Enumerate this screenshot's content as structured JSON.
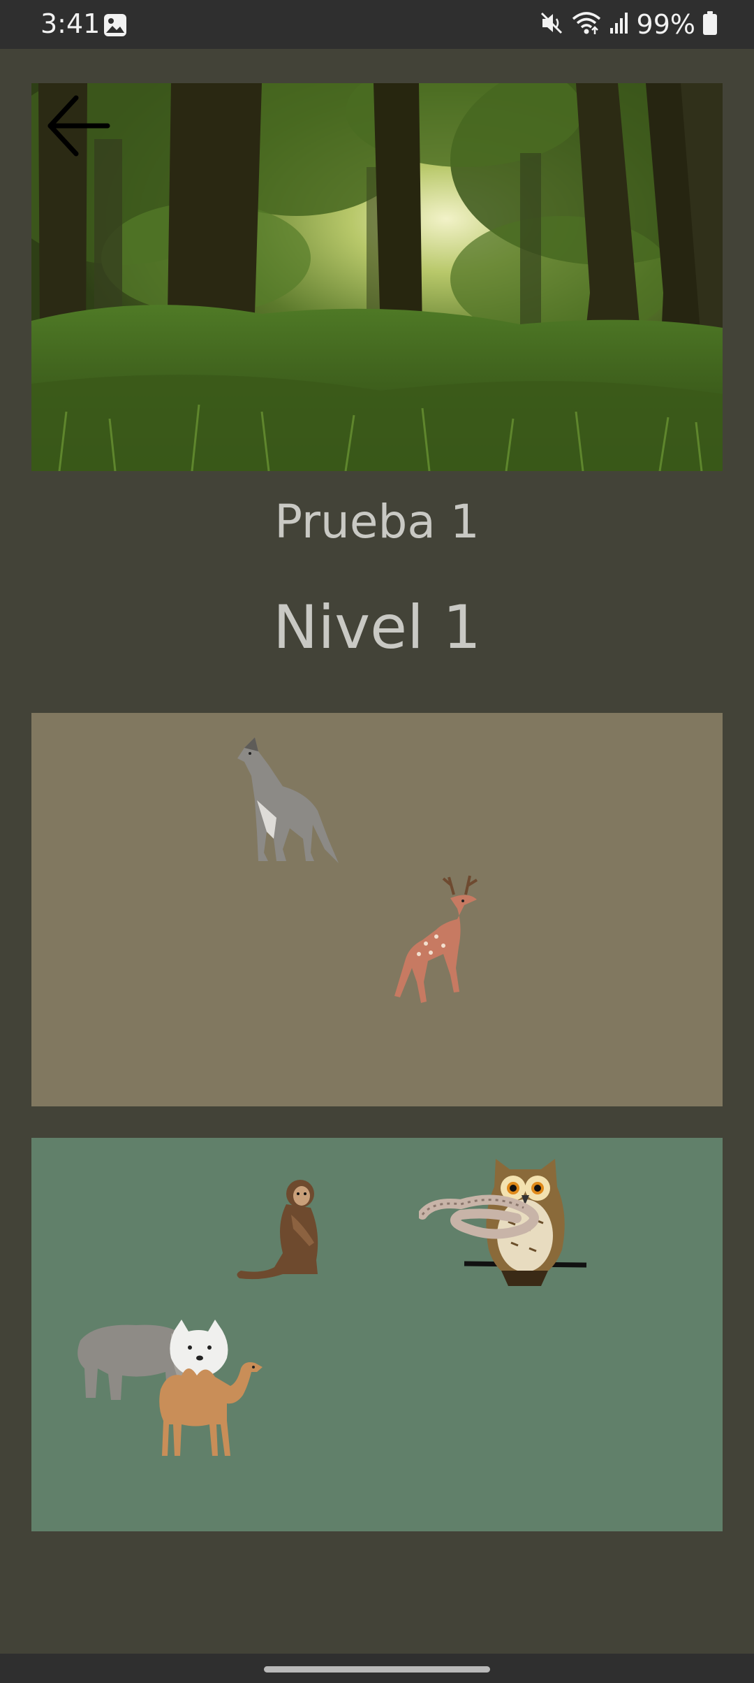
{
  "status_bar": {
    "time": "3:41",
    "battery": "99%",
    "icons": [
      "image-icon",
      "mute-icon",
      "wifi-icon",
      "signal-icon",
      "battery-icon"
    ]
  },
  "header": {
    "back_icon": "arrow-left-icon",
    "image": "forest-scene"
  },
  "main": {
    "title": "Prueba 1",
    "level": "Nivel 1"
  },
  "top_panel": {
    "color": "#817860",
    "animals": [
      "wolf",
      "deer"
    ]
  },
  "bottom_panel": {
    "color": "#61806a",
    "animals": [
      "monkey",
      "owl",
      "snake",
      "elephant",
      "arctic-fox",
      "camel"
    ]
  },
  "colors": {
    "background": "#434338",
    "text": "#c9c9c4"
  }
}
